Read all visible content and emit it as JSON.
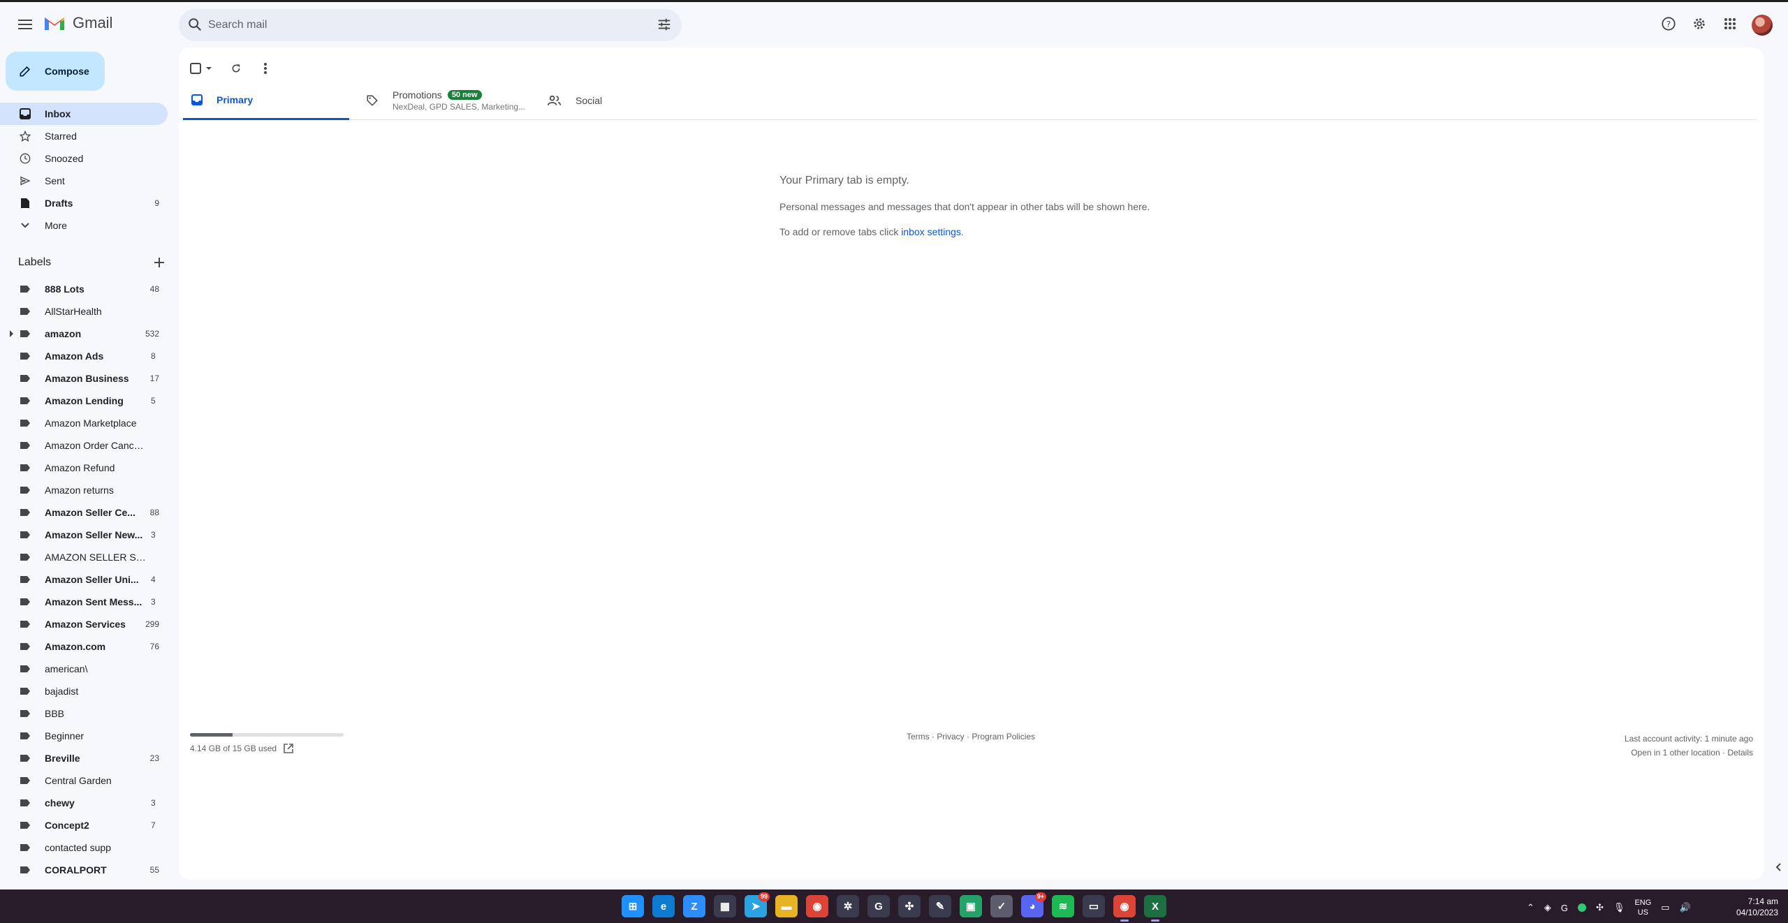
{
  "app": {
    "name": "Gmail"
  },
  "search": {
    "placeholder": "Search mail"
  },
  "compose_label": "Compose",
  "nav": [
    {
      "label": "Inbox",
      "icon": "inbox-icon",
      "count": "",
      "active": true
    },
    {
      "label": "Starred",
      "icon": "star-icon",
      "count": ""
    },
    {
      "label": "Snoozed",
      "icon": "clock-icon",
      "count": ""
    },
    {
      "label": "Sent",
      "icon": "send-icon",
      "count": ""
    },
    {
      "label": "Drafts",
      "icon": "draft-icon",
      "count": "9"
    },
    {
      "label": "More",
      "icon": "chevron-down-icon",
      "count": ""
    }
  ],
  "labels_title": "Labels",
  "labels": [
    {
      "label": "888 Lots",
      "count": "48",
      "bold": true
    },
    {
      "label": "AllStarHealth",
      "count": "",
      "bold": false
    },
    {
      "label": "amazon",
      "count": "532",
      "bold": true,
      "expandable": true
    },
    {
      "label": "Amazon Ads",
      "count": "8",
      "bold": true
    },
    {
      "label": "Amazon Business",
      "count": "17",
      "bold": true
    },
    {
      "label": "Amazon Lending",
      "count": "5",
      "bold": true
    },
    {
      "label": "Amazon Marketplace",
      "count": "",
      "bold": false
    },
    {
      "label": "Amazon Order Cancella...",
      "count": "",
      "bold": false
    },
    {
      "label": "Amazon Refund",
      "count": "",
      "bold": false
    },
    {
      "label": "Amazon returns",
      "count": "",
      "bold": false
    },
    {
      "label": "Amazon Seller Ce...",
      "count": "88",
      "bold": true
    },
    {
      "label": "Amazon Seller New...",
      "count": "3",
      "bold": true
    },
    {
      "label": "AMAZON SELLER SUPP...",
      "count": "",
      "bold": false
    },
    {
      "label": "Amazon Seller Uni...",
      "count": "4",
      "bold": true
    },
    {
      "label": "Amazon Sent Mess...",
      "count": "3",
      "bold": true
    },
    {
      "label": "Amazon Services",
      "count": "299",
      "bold": true
    },
    {
      "label": "Amazon.com",
      "count": "76",
      "bold": true
    },
    {
      "label": "american\\",
      "count": "",
      "bold": false
    },
    {
      "label": "bajadist",
      "count": "",
      "bold": false
    },
    {
      "label": "BBB",
      "count": "",
      "bold": false
    },
    {
      "label": "Beginner",
      "count": "",
      "bold": false
    },
    {
      "label": "Breville",
      "count": "23",
      "bold": true
    },
    {
      "label": "Central Garden",
      "count": "",
      "bold": false
    },
    {
      "label": "chewy",
      "count": "3",
      "bold": true
    },
    {
      "label": "Concept2",
      "count": "7",
      "bold": true
    },
    {
      "label": "contacted supp",
      "count": "",
      "bold": false
    },
    {
      "label": "CORALPORT",
      "count": "55",
      "bold": true
    }
  ],
  "tabs": {
    "primary": "Primary",
    "promotions": "Promotions",
    "promotions_badge": "50 new",
    "promotions_sub": "NexDeal, GPD SALES, Marketing...",
    "social": "Social"
  },
  "empty": {
    "title": "Your Primary tab is empty.",
    "line1": "Personal messages and messages that don't appear in other tabs will be shown here.",
    "line2_prefix": "To add or remove tabs click ",
    "line2_link": "inbox settings",
    "line2_suffix": "."
  },
  "storage": {
    "text": "4.14 GB of 15 GB used",
    "fraction": 0.276
  },
  "footer": {
    "terms": "Terms",
    "privacy": "Privacy",
    "policies": "Program Policies",
    "activity": "Last account activity: 1 minute ago",
    "location_text": "Open in 1 other location · ",
    "details": "Details"
  },
  "taskbar": {
    "apps": [
      {
        "name": "windows-start-icon",
        "glyph": "⊞",
        "color": "#1e90ff"
      },
      {
        "name": "edge-icon",
        "glyph": "e",
        "color": "#0c7bd1"
      },
      {
        "name": "zoom-icon",
        "glyph": "Z",
        "color": "#2d8cff"
      },
      {
        "name": "calculator-icon",
        "glyph": "▦",
        "color": "#3b3b4f"
      },
      {
        "name": "telegram-icon",
        "glyph": "➤",
        "color": "#2aa3e0",
        "badge": "99"
      },
      {
        "name": "file-explorer-icon",
        "glyph": "▬",
        "color": "#e8b323"
      },
      {
        "name": "chrome-icon",
        "glyph": "◉",
        "color": "#db4437"
      },
      {
        "name": "settings-app-icon",
        "glyph": "✲",
        "color": "#3b3b4f"
      },
      {
        "name": "app-g-icon",
        "glyph": "G",
        "color": "#3b3b4f"
      },
      {
        "name": "pinwheel-icon",
        "glyph": "✣",
        "color": "#3b3b4f"
      },
      {
        "name": "pen-icon",
        "glyph": "✎",
        "color": "#3b3b4f"
      },
      {
        "name": "square-app-icon",
        "glyph": "▣",
        "color": "#26a269"
      },
      {
        "name": "check-app-icon",
        "glyph": "✓",
        "color": "#5c5c6e"
      },
      {
        "name": "discord-icon",
        "glyph": "◕",
        "color": "#5865f2",
        "badge": "9+"
      },
      {
        "name": "spotify-icon",
        "glyph": "≋",
        "color": "#1db954"
      },
      {
        "name": "remote-desktop-icon",
        "glyph": "▭",
        "color": "#3b3b4f"
      },
      {
        "name": "chrome-active-icon",
        "glyph": "◉",
        "color": "#db4437",
        "active": true
      },
      {
        "name": "excel-icon",
        "glyph": "X",
        "color": "#1d6f42",
        "active": true
      }
    ],
    "lang_top": "ENG",
    "lang_bottom": "US",
    "time": "7:14 am",
    "date": "04/10/2023"
  }
}
